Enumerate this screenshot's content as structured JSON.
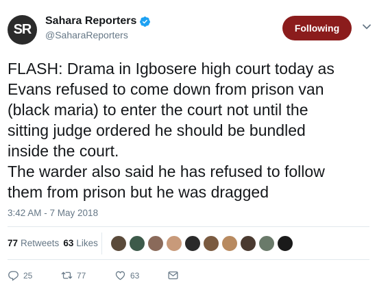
{
  "account": {
    "avatar_text": "SR",
    "display_name": "Sahara Reporters",
    "handle": "@SaharaReporters",
    "verified": true
  },
  "follow_button": {
    "label": "Following",
    "color": "#8b1c1c"
  },
  "tweet": {
    "text": "FLASH: Drama in Igbosere high court today as\nEvans refused to come down from prison van\n(black maria) to enter the court not until the\nsitting judge ordered he should be bundled\ninside the court.\nThe warder also said he has refused to follow\nthem from prison but he was dragged",
    "timestamp": "3:42 AM - 7 May 2018"
  },
  "stats": {
    "retweets_count": "77",
    "retweets_label": "Retweets",
    "likes_count": "63",
    "likes_label": "Likes"
  },
  "liker_faces": [
    "#5a4a3a",
    "#3d5a4a",
    "#8a6a5a",
    "#c89a7a",
    "#2a2a2a",
    "#7a5a40",
    "#b88a60",
    "#4a3a30",
    "#6a7a6a",
    "#1a1a1a"
  ],
  "actions": {
    "reply_count": "25",
    "retweet_count": "77",
    "like_count": "63",
    "icons": [
      "reply-icon",
      "retweet-icon",
      "heart-icon",
      "message-icon"
    ]
  }
}
